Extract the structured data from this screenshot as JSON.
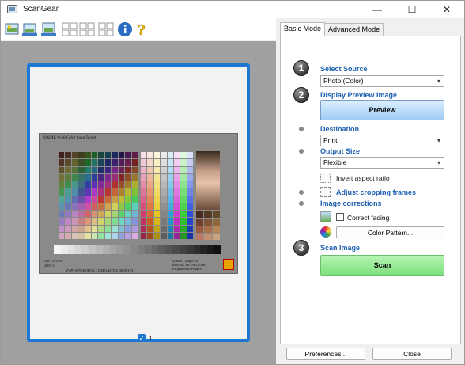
{
  "window": {
    "title": "ScanGear",
    "minimize_glyph": "—",
    "maximize_glyph": "☐",
    "close_glyph": "✕"
  },
  "toolbar": {
    "icons": [
      "preview-image-icon",
      "thumbnail-view-icon",
      "whole-image-view-icon",
      "select-all-frames-icon",
      "clear-frames-icon",
      "info-icon",
      "help-icon"
    ]
  },
  "preview": {
    "page_number": "1",
    "page_checked": true,
    "target": {
      "header": "KODAK Q-60 Color Input Target",
      "footer_left_line1": "IT8.7/2-1993",
      "footer_left_line2": "2007:11",
      "footer_center": "FTP://FTP.KODAK.COM/GASTDS/Q60DATA",
      "footer_right_line1": "Q-60R1 Target for",
      "footer_right_line2": "KODAK EKTACOLOR",
      "footer_right_line3": "Professional Papers"
    }
  },
  "tabs": [
    {
      "label": "Basic Mode",
      "active": true
    },
    {
      "label": "Advanced Mode",
      "active": false
    }
  ],
  "steps": {
    "select_source": {
      "number": "1",
      "label": "Select Source",
      "value": "Photo (Color)"
    },
    "display_preview": {
      "number": "2",
      "label": "Display Preview Image",
      "button": "Preview"
    },
    "destination": {
      "label": "Destination",
      "value": "Print"
    },
    "output_size": {
      "label": "Output Size",
      "value": "Flexible",
      "invert_label": "Invert aspect ratio"
    },
    "adjust_cropping": {
      "label": "Adjust cropping frames"
    },
    "image_corrections": {
      "label": "Image corrections",
      "correct_fading_label": "Correct fading",
      "correct_fading_checked": false,
      "color_pattern_button": "Color Pattern..."
    },
    "scan_image": {
      "number": "3",
      "label": "Scan Image",
      "button": "Scan"
    }
  },
  "footer": {
    "preferences_button": "Preferences...",
    "close_button": "Close"
  },
  "colors": {
    "accent_blue": "#1e77d2",
    "label_blue": "#1b5fb0",
    "preview_button": "#9fcdf4",
    "scan_button": "#7fe07c"
  }
}
